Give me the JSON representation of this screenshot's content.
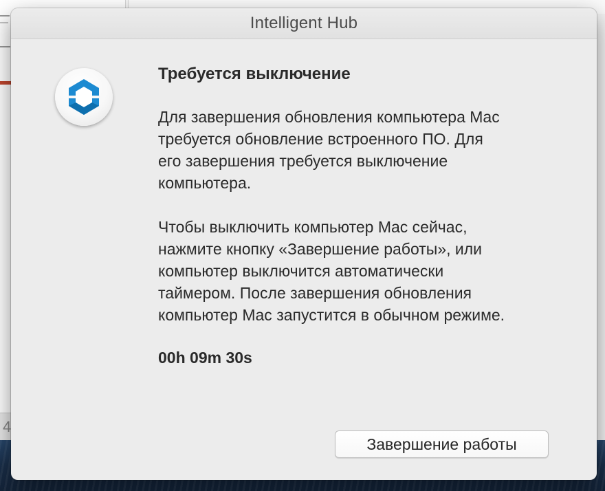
{
  "window": {
    "title": "Intelligent Hub"
  },
  "app_icon": {
    "name": "intelligent-hub-logo-icon",
    "colors": {
      "primary": "#1c8ad1",
      "dark": "#0e6fae"
    }
  },
  "dialog": {
    "heading": "Требуется выключение",
    "paragraph1": "Для завершения обновления компьютера Mac\nтребуется обновление встроенного ПО. Для\nего завершения требуется выключение\nкомпьютера.",
    "paragraph2": "Чтобы выключить компьютер Mac сейчас,\nнажмите кнопку «Завершение работы», или\nкомпьютер выключится автоматически\nтаймером. После завершения обновления\nкомпьютер Mac запустится в обычном режиме.",
    "countdown": "00h 09m 30s",
    "shutdown_button_label": "Завершение работы"
  },
  "background": {
    "partial_digit": "4"
  }
}
